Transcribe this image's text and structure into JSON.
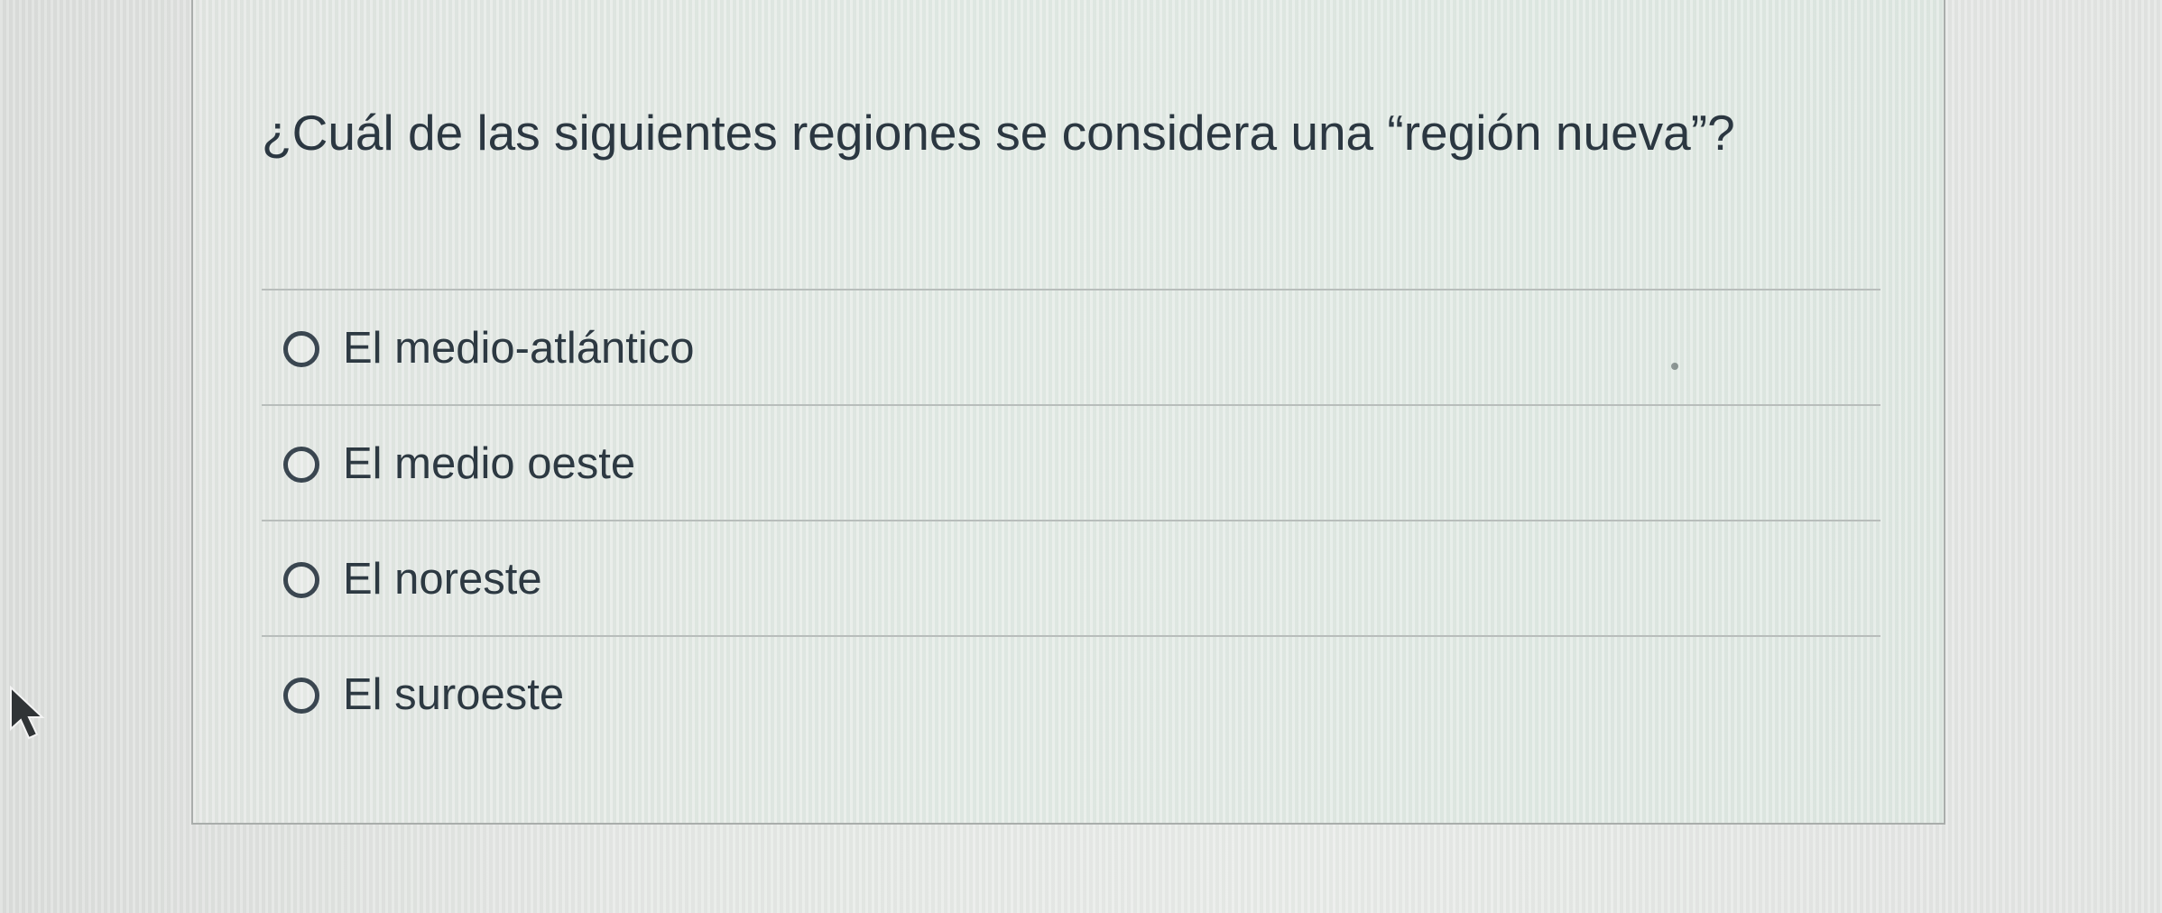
{
  "question": {
    "text": "¿Cuál de las siguientes regiones se considera una “región nueva”?"
  },
  "answers": [
    {
      "label": "El medio-atlántico",
      "selected": false
    },
    {
      "label": "El medio oeste",
      "selected": false
    },
    {
      "label": "El noreste",
      "selected": false
    },
    {
      "label": "El suroeste",
      "selected": false
    }
  ],
  "colors": {
    "text": "#2d3b45",
    "border": "#a9adab",
    "divider": "#b8bdbb",
    "background": "#e4e6e4"
  },
  "icons": {
    "cursor": "mouse-pointer-icon",
    "radio": "radio-button-icon"
  }
}
